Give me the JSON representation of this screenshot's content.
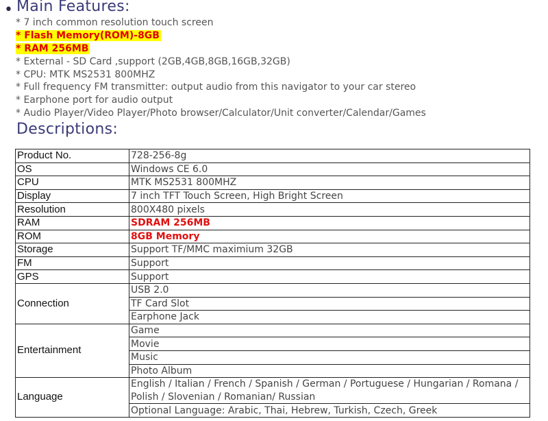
{
  "main_features": {
    "title": "Main Features:",
    "bullet": "•",
    "items": [
      {
        "text": "* 7 inch common resolution touch screen",
        "highlight": false
      },
      {
        "text": "* Flash Memory(ROM)-8GB",
        "highlight": true
      },
      {
        "text": "* RAM 256MB",
        "highlight": true
      },
      {
        "text": "* External - SD Card ,support (2GB,4GB,8GB,16GB,32GB)",
        "highlight": false
      },
      {
        "text": "* CPU: MTK MS2531 800MHZ",
        "highlight": false
      },
      {
        "text": "* Full frequency FM transmitter: output audio from this navigator to your car stereo",
        "highlight": false
      },
      {
        "text": "* Earphone port for audio output",
        "highlight": false
      },
      {
        "text": "* Audio Player/Video Player/Photo browser/Calculator/Unit converter/Calendar/Games",
        "highlight": false
      }
    ]
  },
  "descriptions": {
    "title": "Descriptions:",
    "rows": [
      {
        "key": "Product No.",
        "values": [
          "728-256-8g"
        ]
      },
      {
        "key": "OS",
        "values": [
          "Windows CE 6.0"
        ]
      },
      {
        "key": "CPU",
        "values": [
          "MTK MS2531 800MHZ"
        ]
      },
      {
        "key": "Display",
        "values": [
          "7 inch TFT Touch Screen, High Bright Screen"
        ]
      },
      {
        "key": "Resolution",
        "values": [
          "800X480 pixels"
        ]
      },
      {
        "key": "RAM",
        "values": [
          "SDRAM 256MB"
        ],
        "emphasis": true
      },
      {
        "key": "ROM",
        "values": [
          "8GB Memory"
        ],
        "emphasis": true
      },
      {
        "key": "Storage",
        "values": [
          "Support TF/MMC maximium 32GB"
        ]
      },
      {
        "key": "FM",
        "values": [
          "Support"
        ]
      },
      {
        "key": "GPS",
        "values": [
          "Support"
        ]
      },
      {
        "key": "Connection",
        "values": [
          "USB 2.0",
          "TF Card Slot",
          "Earphone Jack"
        ]
      },
      {
        "key": "Entertainment",
        "values": [
          "Game",
          "Movie",
          "Music",
          "Photo Album"
        ]
      },
      {
        "key": "Language",
        "values": [
          "English / Italian / French / Spanish / German / Portuguese / Hungarian / Romana /",
          "Polish / Slovenian / Romanian/ Russian",
          "Optional Language: Arabic, Thai, Hebrew, Turkish, Czech, Greek"
        ],
        "merged_last_two": true
      }
    ]
  },
  "colors": {
    "heading": "#3a3a78",
    "highlight_bg": "#ffff00",
    "highlight_text": "#e00000",
    "emphasis_text": "#e01010"
  }
}
